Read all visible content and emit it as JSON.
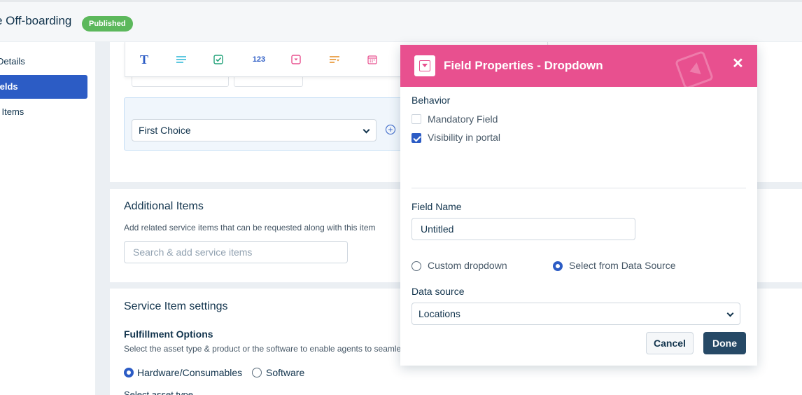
{
  "header": {
    "title": "e Off-boarding",
    "status": "Published"
  },
  "sidebar": {
    "items": [
      {
        "label": "Details"
      },
      {
        "label": "ields"
      },
      {
        "label": "l Items"
      }
    ]
  },
  "form": {
    "first_choice": "First Choice",
    "additional_items": {
      "title": "Additional Items",
      "help": "Add related service items that can be requested along with this item",
      "search_placeholder": "Search & add service items"
    },
    "settings": {
      "title": "Service Item settings",
      "fulfillment_title": "Fulfillment Options",
      "fulfillment_help": "Select the asset type & product or the software to enable agents to seamle",
      "option_hardware": "Hardware/Consumables",
      "option_software": "Software",
      "cut_text": "Select asset type"
    }
  },
  "modal": {
    "title": "Field Properties - Dropdown",
    "behavior_label": "Behavior",
    "mandatory_label": "Mandatory Field",
    "mandatory_checked": false,
    "visibility_label": "Visibility in portal",
    "visibility_checked": true,
    "field_name_label": "Field Name",
    "field_name_value": "Untitled",
    "option_custom": "Custom dropdown",
    "option_datasource": "Select from Data Source",
    "data_source_label": "Data source",
    "data_source_value": "Locations",
    "cancel_label": "Cancel",
    "done_label": "Done"
  },
  "colors": {
    "accent": "#2c5cc5",
    "modal_header": "#e8508f",
    "published": "#5cb85c",
    "done_button": "#264966"
  }
}
